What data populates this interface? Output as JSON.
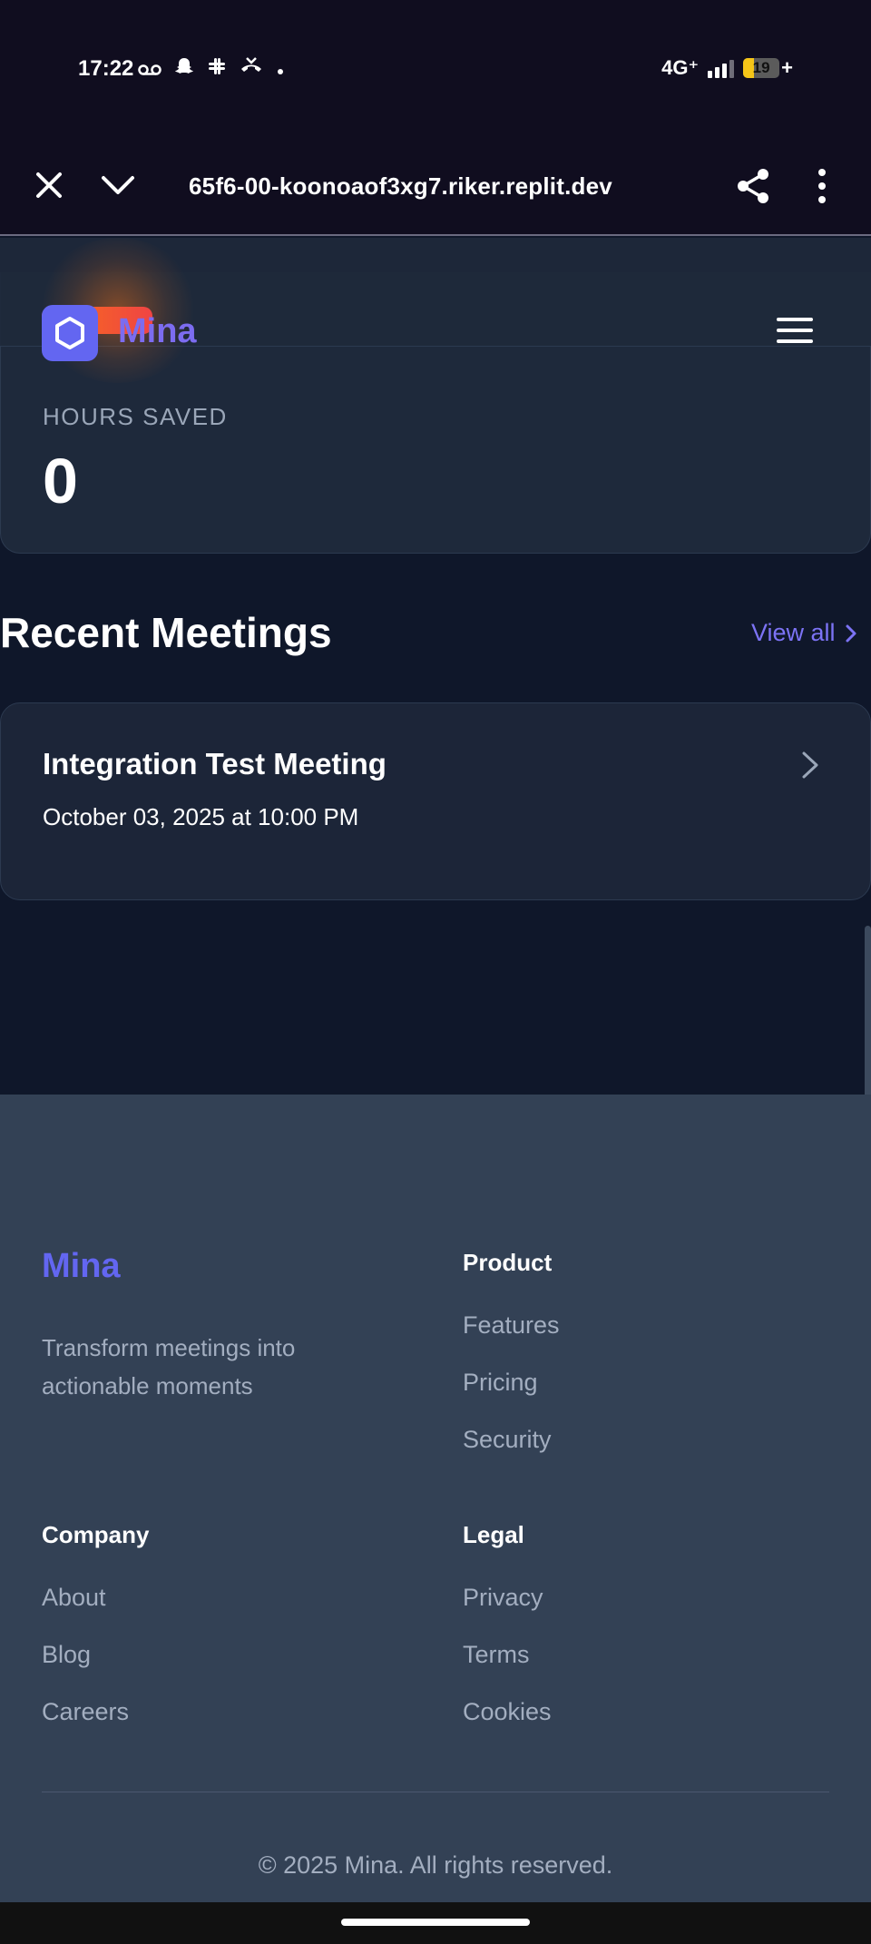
{
  "status_bar": {
    "time": "17:22",
    "network": "4G⁺",
    "battery": "19",
    "charging": "+"
  },
  "browser": {
    "url": "65f6-00-koonoaof3xg7.riker.replit.dev"
  },
  "header": {
    "brand": "Mina"
  },
  "stats": {
    "hours_saved_label": "HOURS SAVED",
    "hours_saved_value": "0"
  },
  "recent_meetings": {
    "title": "Recent Meetings",
    "view_all": "View all",
    "items": [
      {
        "title": "Integration Test Meeting",
        "date": "October 03, 2025 at 10:00 PM"
      }
    ]
  },
  "footer": {
    "brand": "Mina",
    "tagline": "Transform meetings into actionable moments",
    "product": {
      "heading": "Product",
      "links": [
        "Features",
        "Pricing",
        "Security"
      ]
    },
    "company": {
      "heading": "Company",
      "links": [
        "About",
        "Blog",
        "Careers"
      ]
    },
    "legal": {
      "heading": "Legal",
      "links": [
        "Privacy",
        "Terms",
        "Cookies"
      ]
    },
    "copyright": "© 2025 Mina. All rights reserved."
  },
  "colors": {
    "accent": "#6366f1",
    "page_bg": "#0f172a",
    "card_bg": "#1e293b",
    "footer_bg": "#334155"
  }
}
